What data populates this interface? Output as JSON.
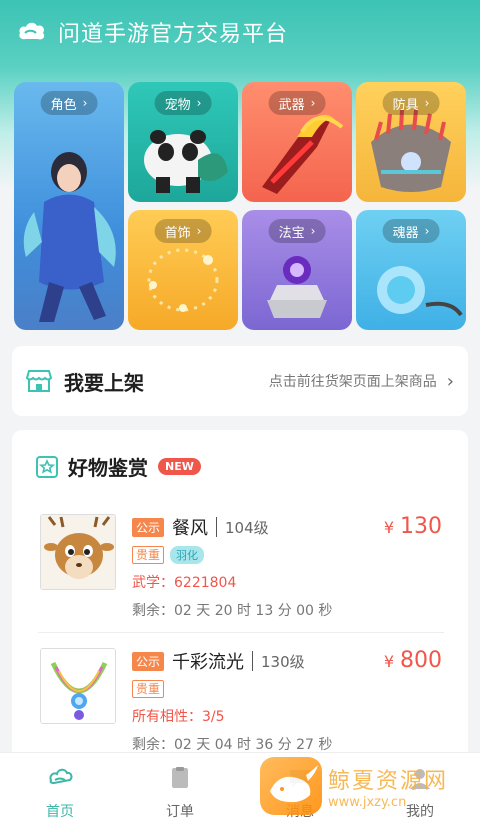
{
  "header": {
    "title": "问道手游官方交易平台",
    "logo": "cloud-logo-icon"
  },
  "categories": [
    {
      "label": "角色",
      "chevron": "›",
      "art": "character"
    },
    {
      "label": "宠物",
      "chevron": "›",
      "art": "panda-pet"
    },
    {
      "label": "武器",
      "chevron": "›",
      "art": "fire-claw"
    },
    {
      "label": "防具",
      "chevron": "›",
      "art": "feather-armor"
    },
    {
      "label": "首饰",
      "chevron": "›",
      "art": "bead-necklace"
    },
    {
      "label": "法宝",
      "chevron": "›",
      "art": "stone-treasure"
    },
    {
      "label": "魂器",
      "chevron": "›",
      "art": "water-orb"
    }
  ],
  "shelf": {
    "title": "我要上架",
    "subtitle": "点击前往货架页面上架商品",
    "arrow": "›",
    "icon": "shop-icon"
  },
  "goods": {
    "title": "好物鉴赏",
    "badge": "NEW",
    "icon": "star-icon",
    "items": [
      {
        "status_tag": "公示",
        "name": "餐风",
        "level": "104级",
        "price_symbol": "¥",
        "price": "130",
        "tags": [
          "贵重",
          "羽化"
        ],
        "stat": "武学：6221804",
        "remaining": "剩余：02 天 20 时 13 分 00 秒",
        "thumb": "deer-pet"
      },
      {
        "status_tag": "公示",
        "name": "千彩流光",
        "level": "130级",
        "price_symbol": "¥",
        "price": "800",
        "tags": [
          "贵重"
        ],
        "stat": "所有相性：3/5",
        "remaining": "剩余：02 天 04 时 36 分 27 秒",
        "thumb": "rainbow-necklace"
      }
    ]
  },
  "nav": [
    {
      "label": "首页",
      "icon": "home-icon",
      "active": true
    },
    {
      "label": "订单",
      "icon": "order-icon",
      "active": false
    },
    {
      "label": "消息",
      "icon": "message-icon",
      "active": false
    },
    {
      "label": "我的",
      "icon": "profile-icon",
      "active": false
    }
  ],
  "watermark": {
    "title": "鲸夏资源网",
    "url": "www.jxzy.cn"
  },
  "colors": {
    "accent": "#3cc3b4",
    "price": "#f0564a",
    "tag": "#f6874c"
  }
}
